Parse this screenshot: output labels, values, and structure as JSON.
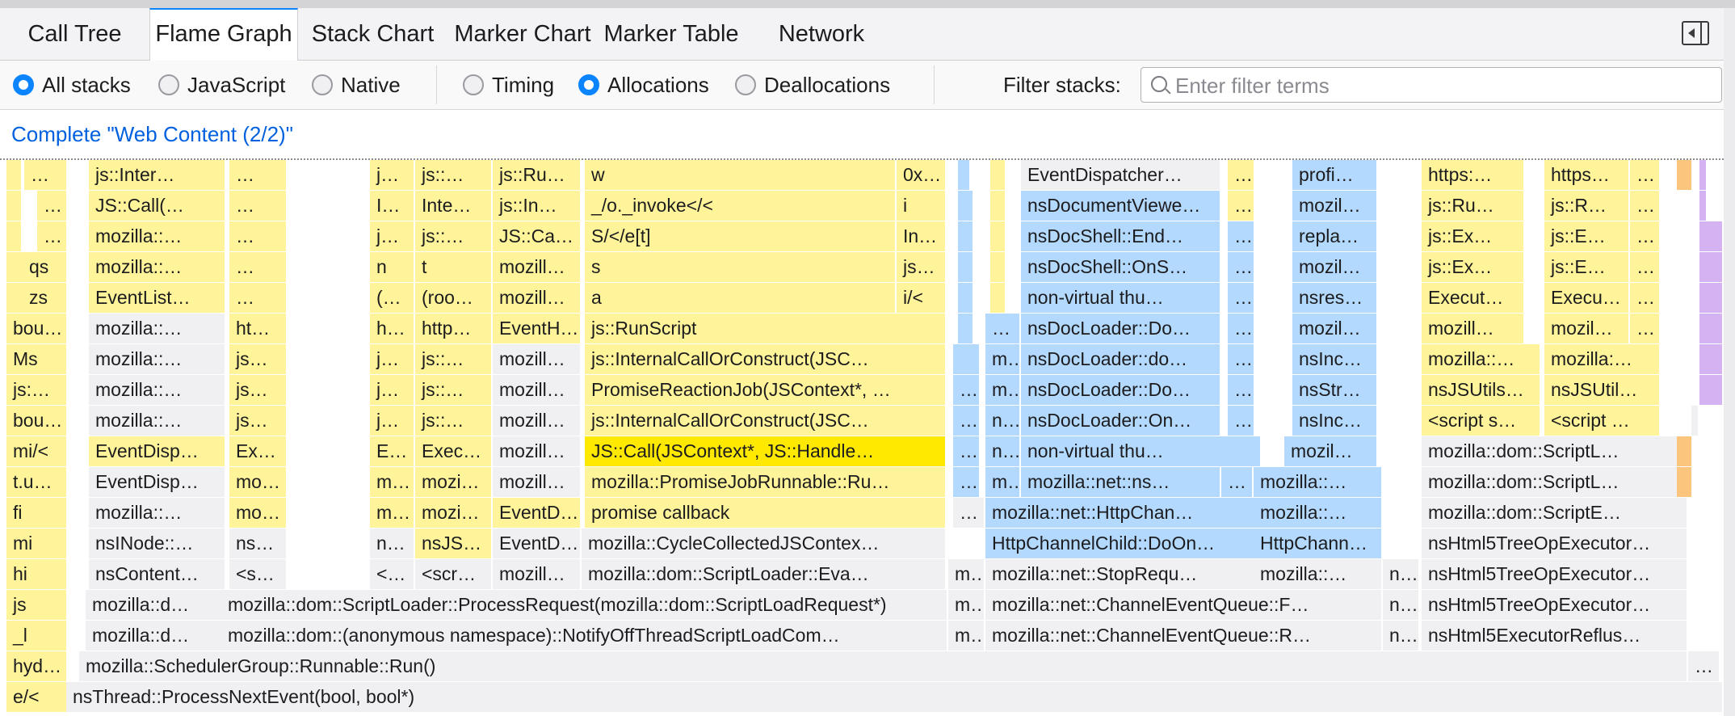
{
  "tabs": [
    {
      "label": "Call Tree",
      "selected": false
    },
    {
      "label": "Flame Graph",
      "selected": true
    },
    {
      "label": "Stack Chart",
      "selected": false
    },
    {
      "label": "Marker Chart",
      "selected": false
    },
    {
      "label": "Marker Table",
      "selected": false
    },
    {
      "label": "Network",
      "selected": false
    }
  ],
  "settings": {
    "stack_type": {
      "all_stacks": "All stacks",
      "javascript": "JavaScript",
      "native": "Native",
      "selected": "All stacks"
    },
    "summary": {
      "timing": "Timing",
      "allocations": "Allocations",
      "deallocations": "Deallocations",
      "selected": "Allocations"
    },
    "filter_label": "Filter stacks:",
    "filter_placeholder": "Enter filter terms",
    "filter_value": ""
  },
  "breadcrumb": "Complete \"Web Content (2/2)\"",
  "colors": {
    "js": "#fff49a",
    "graph": "#f0f0f2",
    "dom": "#b3d9ff",
    "selected": "#ffe900",
    "purple": "#d5b2f2",
    "orange": "#fbc57d",
    "accent": "#0a84ff"
  },
  "flame_rows": [
    [
      "…",
      "js::Inter…",
      "…",
      "j…",
      "js::…",
      "js::Ru…",
      "w",
      "0x…",
      "EventDispatcher…",
      "…",
      "profi…",
      "https:…",
      "https…",
      "…"
    ],
    [
      "…",
      "JS::Call(…",
      "…",
      "I…",
      "Inte…",
      "js::In…",
      "_/o._invoke</<",
      "i",
      "nsDocumentViewe…",
      "…",
      "mozil…",
      "js::Ru…",
      "js::R…",
      "…"
    ],
    [
      "…",
      "mozilla::…",
      "…",
      "j…",
      "js::…",
      "JS::Ca…",
      "S/</e[t]",
      "In…",
      "nsDocShell::End…",
      "…",
      "repla…",
      "js::Ex…",
      "js::E…",
      "…"
    ],
    [
      "qs",
      "mozilla::…",
      "…",
      "n",
      "t",
      "mozill…",
      "s",
      "js…",
      "nsDocShell::OnS…",
      "…",
      "mozil…",
      "js::Ex…",
      "js::E…",
      "…"
    ],
    [
      "zs",
      "EventList…",
      "…",
      "(…",
      "(roo…",
      "mozill…",
      "a",
      "i/<",
      "non-virtual thu…",
      "…",
      "nsres…",
      "Execut…",
      "Execu…",
      "…"
    ],
    [
      "bou…",
      "mozilla::…",
      "ht…",
      "h…",
      "http…",
      "EventH…",
      "js::RunScript",
      "…",
      "nsDocLoader::Do…",
      "…",
      "mozil…",
      "mozill…",
      "mozil…",
      "…"
    ],
    [
      "Ms",
      "mozilla::…",
      "js…",
      "j…",
      "js::…",
      "mozill…",
      "js::InternalCallOrConstruct(JSC…",
      "m…",
      "nsDocLoader::do…",
      "…",
      "nsInc…",
      "mozilla::…",
      "mozilla:…"
    ],
    [
      "js:…",
      "mozilla::…",
      "js…",
      "j…",
      "js::…",
      "mozill…",
      "PromiseReactionJob(JSContext*, …",
      "…",
      "m…",
      "nsDocLoader::Do…",
      "…",
      "nsStr…",
      "nsJSUtils…",
      "nsJSUtil…"
    ],
    [
      "bou…",
      "mozilla::…",
      "js…",
      "j…",
      "js::…",
      "mozill…",
      "js::InternalCallOrConstruct(JSC…",
      "…",
      "n…",
      "nsDocLoader::On…",
      "…",
      "nsInc…",
      "<script s…",
      "<script …"
    ],
    [
      "mi/<",
      "EventDisp…",
      "Ex…",
      "E…",
      "Exec…",
      "mozill…",
      "JS::Call(JSContext*, JS::Handle…",
      "…",
      "n…",
      "non-virtual thu…",
      "mozil…",
      "mozilla::dom::ScriptL…"
    ],
    [
      "t.u…",
      "EventDisp…",
      "mo…",
      "m…",
      "mozi…",
      "mozill…",
      "mozilla::PromiseJobRunnable::Ru…",
      "…",
      "m…",
      "mozilla::net::ns…",
      "…",
      "mozilla::…",
      "mozilla::dom::ScriptL…"
    ],
    [
      "fi",
      "mozilla::…",
      "mo…",
      "m…",
      "mozi…",
      "EventD…",
      "promise callback",
      "…",
      "mozilla::net::HttpChan…",
      "mozilla::…",
      "mozilla::dom::ScriptE…"
    ],
    [
      "mi",
      "nsINode::…",
      "ns…",
      "n…",
      "nsJS…",
      "EventD…",
      "mozilla::CycleCollectedJSContex…",
      "HttpChannelChild::DoOn…",
      "HttpChann…",
      "nsHtml5TreeOpExecutor…"
    ],
    [
      "hi",
      "nsContent…",
      "<s…",
      "<…",
      "<scr…",
      "mozill…",
      "mozilla::dom::ScriptLoader::Eva…",
      "m…",
      "mozilla::net::StopRequ…",
      "mozilla::…",
      "n…",
      "nsHtml5TreeOpExecutor…"
    ],
    [
      "js",
      "mozilla::d…",
      "mozilla::dom::ScriptLoader::ProcessRequest(mozilla::dom::ScriptLoadRequest*)",
      "m…",
      "mozilla::net::ChannelEventQueue::F…",
      "n…",
      "nsHtml5TreeOpExecutor…"
    ],
    [
      "_l",
      "mozilla::d…",
      "mozilla::dom::(anonymous namespace)::NotifyOffThreadScriptLoadCom…",
      "m…",
      "mozilla::net::ChannelEventQueue::R…",
      "n…",
      "nsHtml5ExecutorReflus…"
    ],
    [
      "hyd…",
      "mozilla::SchedulerGroup::Runnable::Run()",
      "…"
    ],
    [
      "e/<",
      "nsThread::ProcessNextEvent(bool, bool*)"
    ]
  ]
}
